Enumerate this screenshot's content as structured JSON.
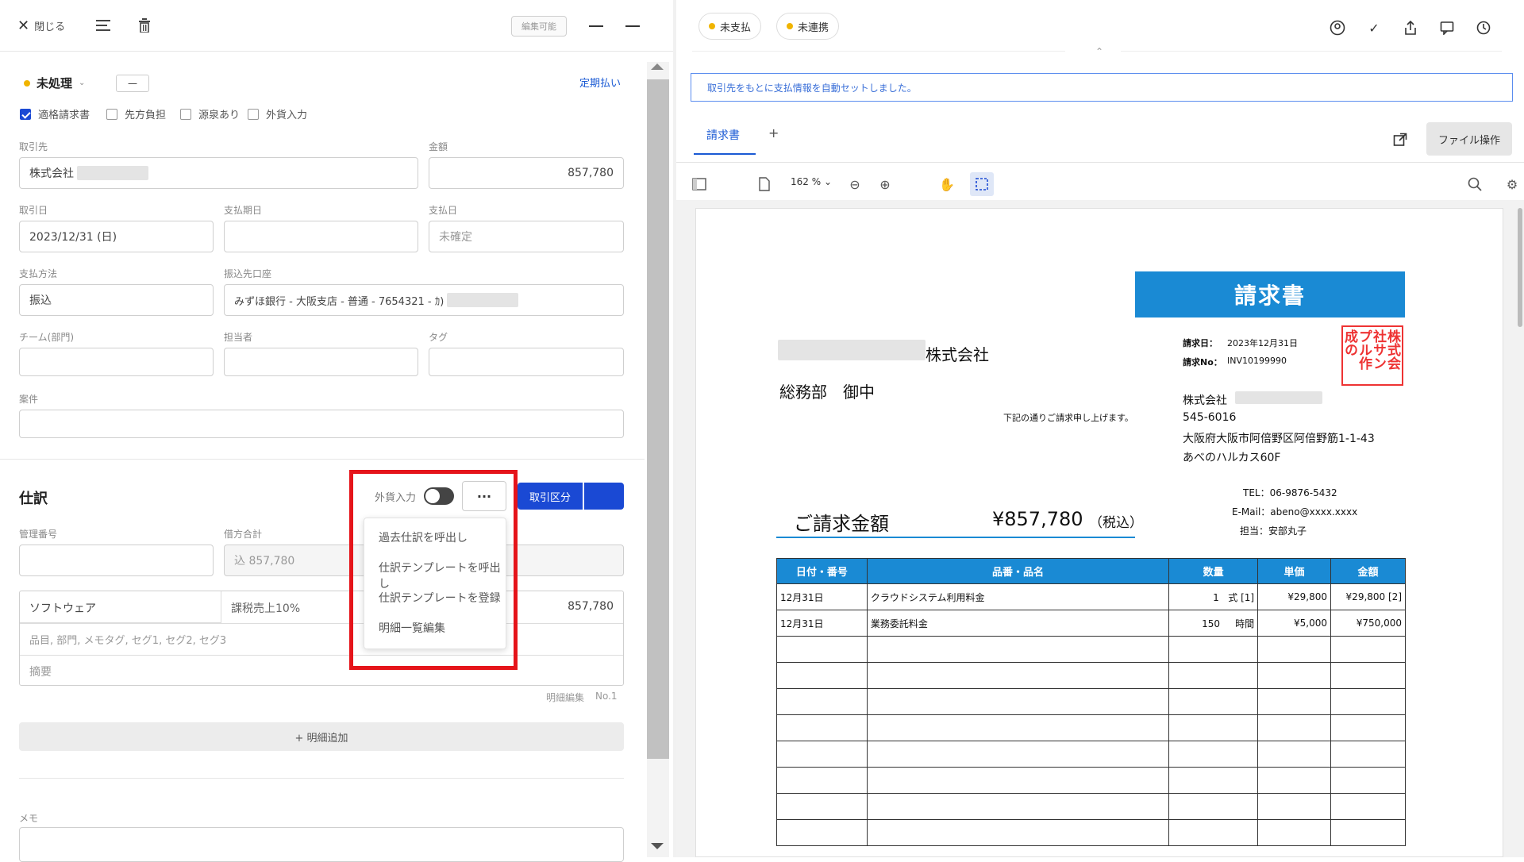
{
  "header": {
    "close_label": "閉じる",
    "edit_badge": "編集可能"
  },
  "status": {
    "label": "未処理",
    "dash": "—",
    "recurring_link": "定期払い"
  },
  "checkboxes": [
    {
      "label": "適格請求書",
      "checked": true
    },
    {
      "label": "先方負担",
      "checked": false
    },
    {
      "label": "源泉あり",
      "checked": false
    },
    {
      "label": "外貨入力",
      "checked": false
    }
  ],
  "form": {
    "partner_label": "取引先",
    "partner_value": "株式会社",
    "amount_label": "金額",
    "amount_value": "857,780",
    "txn_date_label": "取引日",
    "txn_date_value": "2023/12/31 (日)",
    "due_label": "支払期日",
    "due_value": "",
    "paydate_label": "支払日",
    "paydate_value": "未確定",
    "method_label": "支払方法",
    "method_value": "振込",
    "bank_label": "振込先口座",
    "bank_value": "みずほ銀行 - 大阪支店 - 普通 - 7654321 - ｶ)",
    "team_label": "チーム(部門)",
    "owner_label": "担当者",
    "tag_label": "タグ",
    "project_label": "案件"
  },
  "journal": {
    "title": "仕訳",
    "fx_label": "外貨入力",
    "more_label": "···",
    "primary_button": "取引区分",
    "mgmt_no_label": "管理番号",
    "debit_total_label": "借方合計",
    "debit_total_value": "込 857,780",
    "account": "ソフトウェア",
    "tax": "課税売上10%",
    "line_amount": "857,780",
    "line_placeholder": "品目, 部門, メモタグ, セグ1, セグ2, セグ3",
    "memo_placeholder": "摘要",
    "line_edit": "明細編集",
    "line_no": "No.1",
    "add_line": "+ 明細追加",
    "memo_label": "メモ"
  },
  "menu": {
    "items": [
      "過去仕訳を呼出し",
      "仕訳テンプレートを呼出し",
      "仕訳テンプレートを登録",
      "明細一覧編集"
    ]
  },
  "right": {
    "pill_unpaid": "未支払",
    "pill_unlinked": "未連携",
    "info_text": "取引先をもとに支払情報を自動セットしました。",
    "tab_invoice": "請求書",
    "tab_add": "+",
    "file_ops": "ファイル操作",
    "zoom": "162 %"
  },
  "invoice": {
    "title": "請求書",
    "company_suffix": "株式会社",
    "dept": "総務部　御中",
    "greeting": "下記の通りご請求申し上げます。",
    "date_label": "請求日：",
    "date_value": "2023年12月31日",
    "no_label": "請求No：",
    "no_value": "INV10199990",
    "seal": "株式会社サンプル作成の",
    "sender": "株式会社",
    "postal": "545-6016",
    "address1": "大阪府大阪市阿倍野区阿倍野筋1-1-43",
    "address2": "あべのハルカス60F",
    "tel": "TEL：06-9876-5432",
    "email": "E-Mail：abeno@xxxx.xxxx",
    "person": "担当：安部丸子",
    "total_label": "ご請求金額",
    "total_value": "¥857,780",
    "total_tax": "（税込）",
    "columns": [
      "日付・番号",
      "品番・品名",
      "数量",
      "単価",
      "金額"
    ],
    "rows": [
      {
        "date": "12月31日",
        "item": "クラウドシステム利用料金",
        "qty": "1",
        "unit": "式 [1]",
        "price": "¥29,800",
        "amount": "¥29,800",
        "note": "[2]"
      },
      {
        "date": "12月31日",
        "item": "業務委託料金",
        "qty": "150",
        "unit": "時間",
        "price": "¥5,000",
        "amount": "¥750,000",
        "note": ""
      }
    ]
  }
}
